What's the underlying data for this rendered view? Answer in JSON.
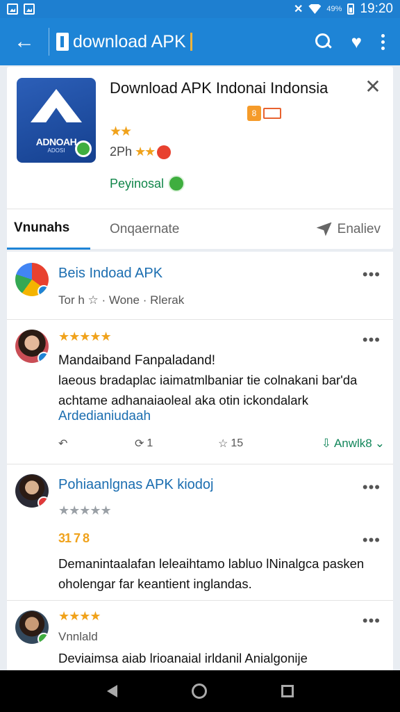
{
  "status_bar": {
    "battery": "49%",
    "time": "19:20"
  },
  "app_bar": {
    "title": "download APK"
  },
  "app_card": {
    "name": "Download APK Indonai Indonsia",
    "icon_text": "ADNOAH",
    "icon_subtext": "ADOSI",
    "stars": "★★",
    "rating_text": "2Ph",
    "rating_stars": "★★",
    "publisher": "Peyinosal",
    "tabs": {
      "active": "Vnunahs",
      "second": "Onqaernate",
      "share": "Enaliev"
    }
  },
  "feed": {
    "post1": {
      "title": "Beis Indoad APK",
      "meta": "Tor h  ☆ · Wone · Rlerak"
    },
    "post2": {
      "stars": "★★★★★",
      "headline": "Mandaiband Fanpaladand!",
      "body": "laeous bradaplac iaimatmlbaniar tie colnakani bar'da achtame adhanaiaoleal aka otin ickondalark",
      "link": "Ardedianiudaah",
      "reply_count": "",
      "retweet_count": "1",
      "like_count": "15",
      "download_label": "Anwlk8"
    },
    "post3": {
      "title": "Pohiaanlgnas APK kiodoj",
      "stars": "★★★★★",
      "score": "31 7 8",
      "body": "Demanintaalafan leleaihtamo labluo lNinalgca pasken oholengar far keantient inglandas."
    },
    "post4": {
      "stars": "★★★★",
      "meta": "Vnnlald",
      "body": "Deviaimsa aiab lrioanaial irldanil Anialgonije"
    }
  },
  "colors": {
    "primary": "#1e84d6",
    "star": "#f0a21b",
    "link": "#1a6db0",
    "green": "#12865a"
  }
}
